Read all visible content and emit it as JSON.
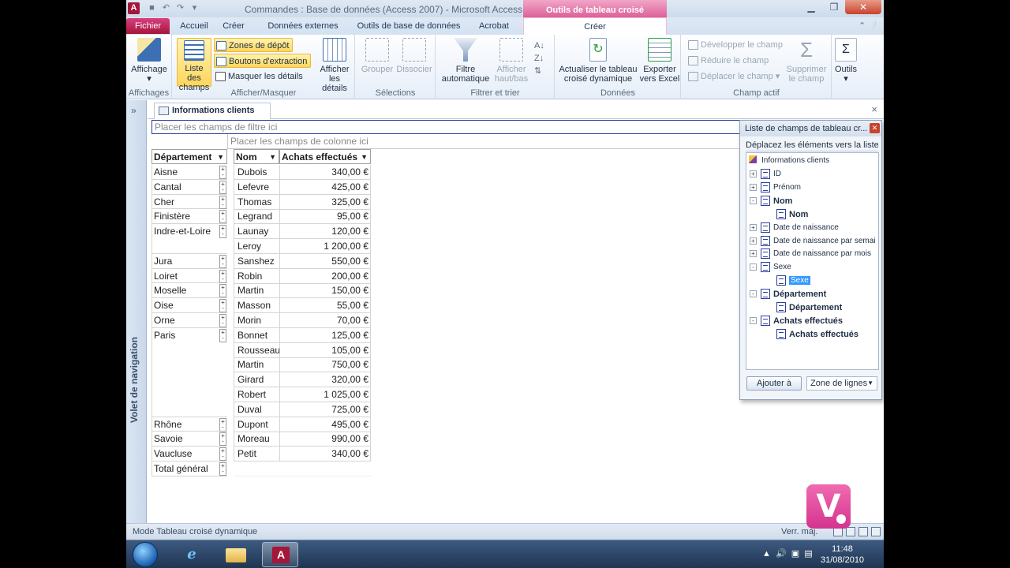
{
  "window": {
    "title": "Commandes : Base de données (Access 2007)  -  Microsoft Access",
    "contextual_header": "Outils de tableau croisé dynamique",
    "app_icon_letter": "A"
  },
  "tabs": {
    "fichier": "Fichier",
    "accueil": "Accueil",
    "creer": "Créer",
    "donnees_externes": "Données externes",
    "outils_bdd": "Outils de base de données",
    "acrobat": "Acrobat",
    "creer_ctx": "Créer"
  },
  "ribbon": {
    "affichage": {
      "label": "Affichage",
      "group": "Affichages"
    },
    "afficher_masquer": {
      "liste_champs": "Liste des champs",
      "zones_depot": "Zones de dépôt",
      "boutons_extraction": "Boutons d'extraction",
      "masquer_details": "Masquer les détails",
      "afficher_details": "Afficher les détails",
      "group": "Afficher/Masquer"
    },
    "selections": {
      "grouper": "Grouper",
      "dissocier": "Dissocier",
      "group": "Sélections"
    },
    "filtrer_trier": {
      "filtre_auto": "Filtre automatique",
      "afficher_haut_bas": "Afficher haut/bas",
      "group": "Filtrer et trier"
    },
    "donnees": {
      "actualiser": "Actualiser le tableau croisé dynamique",
      "exporter": "Exporter vers Excel",
      "group": "Données"
    },
    "champ_actif": {
      "developper": "Développer le champ",
      "reduire": "Réduire le champ",
      "deplacer": "Déplacer le champ",
      "supprimer": "Supprimer le champ",
      "group": "Champ actif"
    },
    "outils": {
      "label": "Outils",
      "sigma": "Σ"
    }
  },
  "nav_pane": {
    "label": "Volet de navigation",
    "toggle": "»"
  },
  "document": {
    "tab_title": "Informations clients",
    "close": "×"
  },
  "pivot": {
    "filter_drop": "Placer les champs de filtre ici",
    "column_drop": "Placer les champs de colonne ici",
    "headers": {
      "departement": "Département",
      "nom": "Nom",
      "achats": "Achats effectués"
    },
    "groups": [
      {
        "dept": "Aisne",
        "rows": [
          {
            "nom": "Dubois",
            "achats": "340,00 €"
          }
        ]
      },
      {
        "dept": "Cantal",
        "rows": [
          {
            "nom": "Lefevre",
            "achats": "425,00 €"
          }
        ]
      },
      {
        "dept": "Cher",
        "rows": [
          {
            "nom": "Thomas",
            "achats": "325,00 €"
          }
        ]
      },
      {
        "dept": "Finistère",
        "rows": [
          {
            "nom": "Legrand",
            "achats": "95,00 €"
          }
        ]
      },
      {
        "dept": "Indre-et-Loire",
        "rows": [
          {
            "nom": "Launay",
            "achats": "120,00 €"
          },
          {
            "nom": "Leroy",
            "achats": "1 200,00 €"
          }
        ]
      },
      {
        "dept": "Jura",
        "rows": [
          {
            "nom": "Sanshez",
            "achats": "550,00 €"
          }
        ]
      },
      {
        "dept": "Loiret",
        "rows": [
          {
            "nom": "Robin",
            "achats": "200,00 €"
          }
        ]
      },
      {
        "dept": "Moselle",
        "rows": [
          {
            "nom": "Martin",
            "achats": "150,00 €"
          }
        ]
      },
      {
        "dept": "Oise",
        "rows": [
          {
            "nom": "Masson",
            "achats": "55,00 €"
          }
        ]
      },
      {
        "dept": "Orne",
        "rows": [
          {
            "nom": "Morin",
            "achats": "70,00 €"
          }
        ]
      },
      {
        "dept": "Paris",
        "rows": [
          {
            "nom": "Bonnet",
            "achats": "125,00 €"
          },
          {
            "nom": "Rousseau",
            "achats": "105,00 €"
          },
          {
            "nom": "Martin",
            "achats": "750,00 €"
          },
          {
            "nom": "Girard",
            "achats": "320,00 €"
          },
          {
            "nom": "Robert",
            "achats": "1 025,00 €"
          },
          {
            "nom": "Duval",
            "achats": "725,00 €"
          }
        ]
      },
      {
        "dept": "Rhône",
        "rows": [
          {
            "nom": "Dupont",
            "achats": "495,00 €"
          }
        ]
      },
      {
        "dept": "Savoie",
        "rows": [
          {
            "nom": "Moreau",
            "achats": "990,00 €"
          }
        ]
      },
      {
        "dept": "Vaucluse",
        "rows": [
          {
            "nom": "Petit",
            "achats": "340,00 €"
          }
        ]
      }
    ],
    "total_label": "Total général"
  },
  "field_list": {
    "title": "Liste de champs de tableau cr...",
    "subtitle": "Déplacez les éléments vers la liste...",
    "root": "Informations clients",
    "items": [
      {
        "label": "ID",
        "level": 1,
        "bold": false,
        "exp": "+"
      },
      {
        "label": "Prénom",
        "level": 1,
        "bold": false,
        "exp": "+"
      },
      {
        "label": "Nom",
        "level": 1,
        "bold": true,
        "exp": "-"
      },
      {
        "label": "Nom",
        "level": 2,
        "bold": true,
        "exp": ""
      },
      {
        "label": "Date de naissance",
        "level": 1,
        "bold": false,
        "exp": "+"
      },
      {
        "label": "Date de naissance par semai",
        "level": 1,
        "bold": false,
        "exp": "+"
      },
      {
        "label": "Date de naissance par mois",
        "level": 1,
        "bold": false,
        "exp": "+"
      },
      {
        "label": "Sexe",
        "level": 1,
        "bold": false,
        "exp": "-"
      },
      {
        "label": "Sexe",
        "level": 2,
        "bold": false,
        "exp": "",
        "selected": true
      },
      {
        "label": "Département",
        "level": 1,
        "bold": true,
        "exp": "-"
      },
      {
        "label": "Département",
        "level": 2,
        "bold": true,
        "exp": ""
      },
      {
        "label": "Achats effectués",
        "level": 1,
        "bold": true,
        "exp": "-"
      },
      {
        "label": "Achats effectués",
        "level": 2,
        "bold": true,
        "exp": ""
      }
    ],
    "add_button": "Ajouter à",
    "zone_value": "Zone de lignes"
  },
  "status": {
    "mode": "Mode Tableau croisé dynamique",
    "verr": "Verr. maj."
  },
  "taskbar": {
    "time": "11:48",
    "date": "31/08/2010"
  },
  "logo": {
    "letter": "V"
  }
}
